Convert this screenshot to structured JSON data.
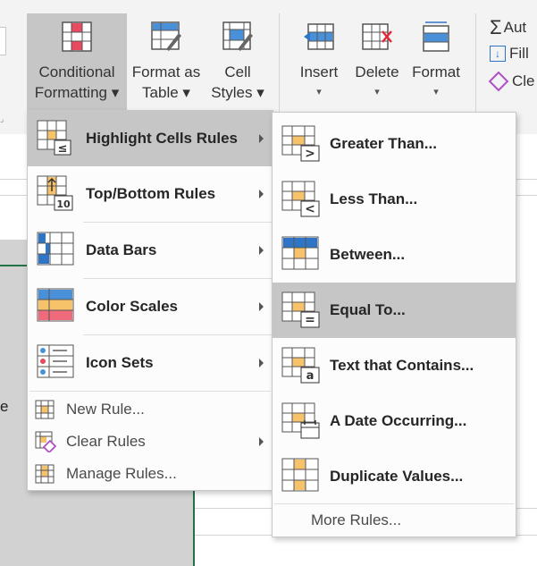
{
  "ribbon": {
    "conditional_formatting": [
      "Conditional",
      "Formatting ▾"
    ],
    "format_as_table": [
      "Format as",
      "Table ▾"
    ],
    "cell_styles": [
      "Cell",
      "Styles ▾"
    ],
    "insert": "Insert",
    "delete": "Delete",
    "format": "Format",
    "autosum": "Aut",
    "fill": "Fill",
    "clear": "Cle",
    "caret": "▾"
  },
  "left_menu": {
    "items": [
      {
        "label": "Highlight Cells Rules",
        "icon": "highlight-cells-icon"
      },
      {
        "label": "Top/Bottom Rules",
        "icon": "top-bottom-icon"
      },
      {
        "label": "Data Bars",
        "icon": "data-bars-icon"
      },
      {
        "label": "Color Scales",
        "icon": "color-scales-icon"
      },
      {
        "label": "Icon Sets",
        "icon": "icon-sets-icon"
      }
    ],
    "small_items": [
      {
        "label": "New Rule...",
        "icon": "new-rule-icon"
      },
      {
        "label": "Clear Rules",
        "icon": "clear-rules-icon"
      },
      {
        "label": "Manage Rules...",
        "icon": "manage-rules-icon"
      }
    ]
  },
  "right_menu": {
    "items": [
      {
        "label": "Greater Than...",
        "icon": "greater-than-icon"
      },
      {
        "label": "Less Than...",
        "icon": "less-than-icon"
      },
      {
        "label": "Between...",
        "icon": "between-icon"
      },
      {
        "label": "Equal To...",
        "icon": "equal-to-icon"
      },
      {
        "label": "Text that Contains...",
        "icon": "text-contains-icon"
      },
      {
        "label": "A Date Occurring...",
        "icon": "date-occurring-icon"
      },
      {
        "label": "Duplicate Values...",
        "icon": "duplicate-values-icon"
      }
    ],
    "more_rules": "More Rules..."
  },
  "sheet": {
    "partial_text": "e"
  }
}
